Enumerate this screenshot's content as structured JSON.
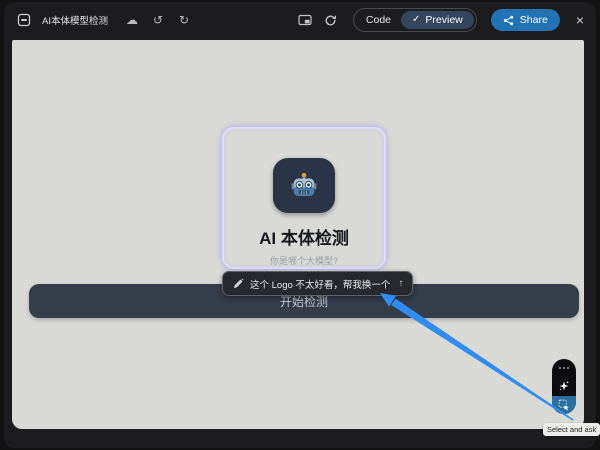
{
  "window": {
    "title": "AI本体模型检测"
  },
  "toolbar": {
    "code_label": "Code",
    "preview_label": "Preview",
    "share_label": "Share"
  },
  "icons": {
    "cloud": "☁",
    "undo": "↺",
    "redo": "↻",
    "check": "✓",
    "close": "×",
    "send": "↑"
  },
  "canvas": {
    "app_title": "AI 本体检测",
    "app_subtitle": "你是哪个大模型?",
    "start_button_label": "开始检测"
  },
  "prompt_bubble": {
    "text": "这个 Logo 不太好看，帮我换一个"
  },
  "selection_toolbar": {
    "tooltip": "Select and ask"
  },
  "colors": {
    "accent_blue": "#2173b4",
    "arrow_blue": "#2f8df2",
    "select_active_blue": "#2a6f9f",
    "highlight_border": "#dedefb"
  }
}
